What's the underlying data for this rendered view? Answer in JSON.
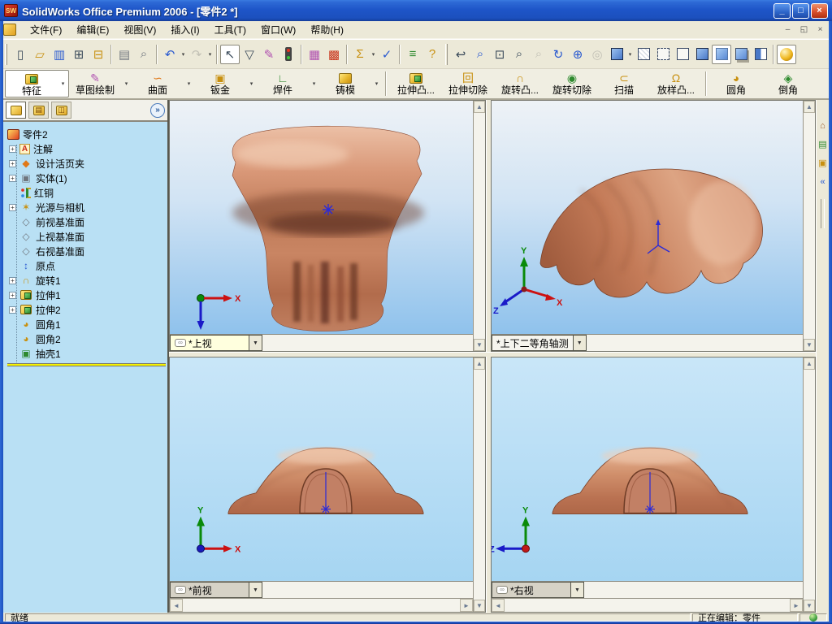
{
  "window": {
    "title": "SolidWorks Office Premium 2006 - [零件2 *]",
    "buttons": {
      "minimize": "_",
      "maximize": "□",
      "close": "×"
    }
  },
  "menubar": {
    "items": [
      "文件(F)",
      "编辑(E)",
      "视图(V)",
      "插入(I)",
      "工具(T)",
      "窗口(W)",
      "帮助(H)"
    ],
    "mdi": {
      "minimize": "–",
      "restore": "◱",
      "close": "×"
    }
  },
  "toolbar": {
    "standard_icons": [
      "new",
      "open",
      "save",
      "make-drawing-from-part",
      "make-assembly-from-part",
      "print",
      "print-preview",
      "undo",
      "redo",
      "select",
      "selection-filter",
      "edit-sketch",
      "rebuild",
      "edit-color",
      "texture",
      "measure",
      "check",
      "options",
      "help"
    ],
    "view_icons": [
      "previous-view",
      "zoom-to-fit",
      "zoom-to-area",
      "zoom-in-out",
      "zoom-to-selection",
      "rotate-view",
      "pan",
      "3d-drawing-view",
      "view-orientation",
      "wireframe",
      "hidden-lines-visible",
      "hidden-lines-removed",
      "shaded-with-edges",
      "shaded",
      "shadows-in-shaded-mode",
      "section-view",
      "realview"
    ]
  },
  "command_manager": {
    "tabs": [
      {
        "label": "特征",
        "active": true
      },
      {
        "label": "草图绘制",
        "active": false
      },
      {
        "label": "曲面",
        "active": false
      },
      {
        "label": "钣金",
        "active": false
      },
      {
        "label": "焊件",
        "active": false
      },
      {
        "label": "铸模",
        "active": false
      }
    ],
    "buttons": [
      "拉伸凸...",
      "拉伸切除",
      "旋转凸...",
      "旋转切除",
      "扫描",
      "放样凸...",
      "圆角",
      "倒角"
    ]
  },
  "feature_tree": {
    "root": "零件2",
    "items": [
      {
        "label": "注解",
        "expandable": true
      },
      {
        "label": "设计活页夹",
        "expandable": true
      },
      {
        "label": "实体(1)",
        "expandable": true
      },
      {
        "label": "红铜",
        "expandable": false
      },
      {
        "label": "光源与相机",
        "expandable": true
      },
      {
        "label": "前视基准面",
        "expandable": false
      },
      {
        "label": "上视基准面",
        "expandable": false
      },
      {
        "label": "右视基准面",
        "expandable": false
      },
      {
        "label": "原点",
        "expandable": false
      },
      {
        "label": "旋转1",
        "expandable": true
      },
      {
        "label": "拉伸1",
        "expandable": true
      },
      {
        "label": "拉伸2",
        "expandable": true
      },
      {
        "label": "圆角1",
        "expandable": false
      },
      {
        "label": "圆角2",
        "expandable": false
      },
      {
        "label": "抽壳1",
        "expandable": false
      }
    ]
  },
  "viewports": [
    {
      "name": "top",
      "label": "*上视",
      "linked": true
    },
    {
      "name": "isometric",
      "label": "*上下二等角轴测",
      "linked": false
    },
    {
      "name": "front",
      "label": "*前视",
      "linked": true
    },
    {
      "name": "right",
      "label": "*右视",
      "linked": true
    }
  ],
  "triad": {
    "x": "X",
    "y": "Y",
    "z": "Z"
  },
  "task_pane": {
    "icons": [
      "solidworks-resources",
      "design-library",
      "file-explorer"
    ]
  },
  "status_bar": {
    "ready": "就绪",
    "editing": "正在编辑：零件"
  },
  "colors": {
    "titlebar_blue": "#1E55C8",
    "panel_blue": "#B9E0F4",
    "viewport_top_gradient": [
      "#EEF2F6",
      "#8FC2EC"
    ],
    "viewport_bottom_blue": "#A6D5F2",
    "copper_light": "#ECC0A6",
    "copper_mid": "#C98563",
    "copper_dark": "#6E3A26",
    "rollback_yellow": "#F6F200"
  },
  "glyphs": {
    "sw": "SW",
    "dropdown": "▼",
    "dropdown_small": "▾",
    "link": "∞",
    "plus": "+",
    "chevron_right": "»",
    "chevron_left": "«",
    "arrow_up": "▲",
    "arrow_down": "▼",
    "arrow_left": "◄",
    "arrow_right": "►",
    "new": "▯",
    "open": "▱",
    "save": "▥",
    "make_drawing": "⊞",
    "make_assembly": "⊟",
    "print": "▤",
    "print_preview": "⌕",
    "undo": "↶",
    "redo": "↷",
    "select": "↖",
    "selection_filter": "▽",
    "edit_sketch": "✎",
    "edit_color": "▦",
    "texture": "▩",
    "measure": "Σ",
    "check": "✓",
    "options": "≡",
    "help": "?",
    "previous_view": "↩",
    "zoom_fit": "⌕",
    "zoom_area": "⊡",
    "zoom_inout": "⌕",
    "zoom_sel": "⌕",
    "rotate": "↻",
    "pan": "⊕",
    "orient3d": "◎",
    "home": "⌂",
    "design_library": "▤",
    "file_explorer": "▣",
    "fm_prop": "▤",
    "fm_config": "◫",
    "ann": "A",
    "binder": "◆",
    "solid": "▣",
    "light": "✶",
    "plane": "◇",
    "origin": "↕",
    "revolve": "∩",
    "fillet": "◕",
    "shell": "▣",
    "sketch_cm": "✎",
    "surface": "∽",
    "sheetmetal": "▣",
    "weld": "∟",
    "cut": "回",
    "revcut": "◉",
    "sweep": "⊂",
    "loft": "Ω",
    "chamfer": "◈"
  }
}
